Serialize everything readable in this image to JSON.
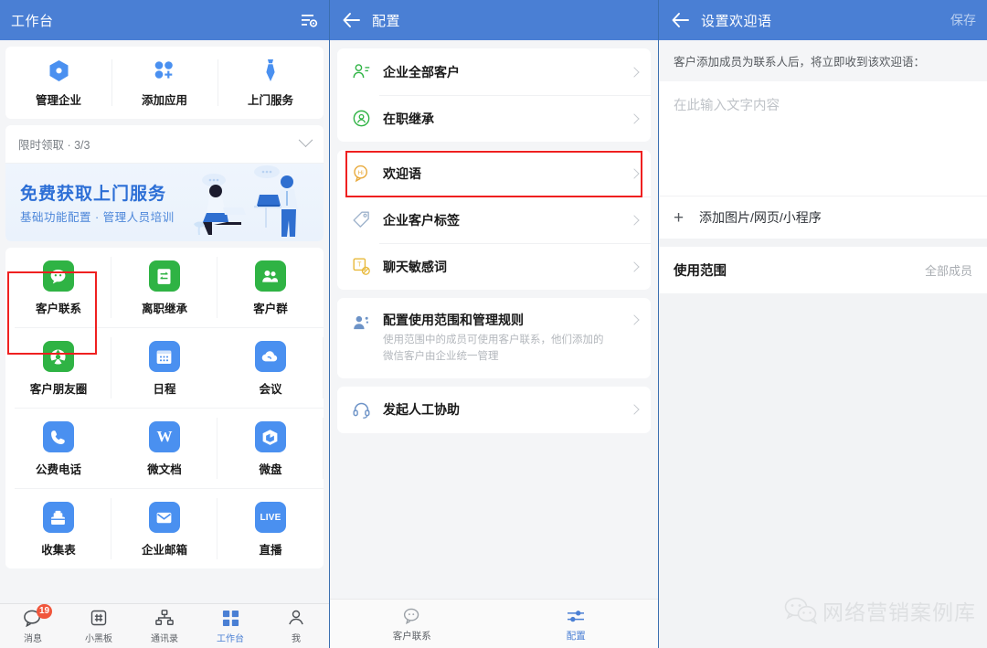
{
  "colors": {
    "appbar": "#4a7fd4",
    "accent": "#4a7fd4",
    "green": "#2fb344",
    "annotation": "#ef2020",
    "badge": "#f0563c"
  },
  "panel1": {
    "header": {
      "title": "工作台",
      "settings_icon": "list-settings-icon"
    },
    "quick_actions": [
      {
        "label": "管理企业",
        "icon": "hexagon-gear-icon"
      },
      {
        "label": "添加应用",
        "icon": "add-app-dots-icon"
      },
      {
        "label": "上门服务",
        "icon": "necktie-icon"
      }
    ],
    "limited": {
      "label": "限时领取 · 3/3",
      "chevron": "chevron-down-icon"
    },
    "banner": {
      "title": "免费获取上门服务",
      "subtitle": "基础功能配置 · 管理人员培训"
    },
    "apps": [
      {
        "label": "客户联系",
        "icon": "wechat-bubble-icon",
        "color": "#2fb344",
        "highlighted": true
      },
      {
        "label": "离职继承",
        "icon": "transfer-icon",
        "color": "#2fb344",
        "highlighted": false
      },
      {
        "label": "客户群",
        "icon": "group-people-icon",
        "color": "#2fb344",
        "highlighted": false
      },
      {
        "label": "客户朋友圈",
        "icon": "camera-shutter-icon",
        "color": "#2fb344",
        "highlighted": false
      },
      {
        "label": "日程",
        "icon": "calendar-icon",
        "color": "#4a90f0",
        "highlighted": false
      },
      {
        "label": "会议",
        "icon": "meeting-cloud-icon",
        "color": "#4a90f0",
        "highlighted": false
      },
      {
        "label": "公费电话",
        "icon": "phone-icon",
        "color": "#4a90f0",
        "highlighted": false
      },
      {
        "label": "微文档",
        "icon": "word-doc-icon",
        "color": "#4a90f0",
        "highlighted": false
      },
      {
        "label": "微盘",
        "icon": "drive-box-icon",
        "color": "#4a90f0",
        "highlighted": false
      },
      {
        "label": "收集表",
        "icon": "collect-form-icon",
        "color": "#4a90f0",
        "highlighted": false
      },
      {
        "label": "企业邮箱",
        "icon": "mail-envelope-icon",
        "color": "#4a90f0",
        "highlighted": false
      },
      {
        "label": "直播",
        "icon": "live-icon",
        "color": "#4a90f0",
        "highlighted": false
      }
    ],
    "tabbar": [
      {
        "label": "消息",
        "icon": "chat-bubble-icon",
        "badge": "19",
        "active": false
      },
      {
        "label": "小黑板",
        "icon": "blackboard-hash-icon",
        "badge": "",
        "active": false
      },
      {
        "label": "通讯录",
        "icon": "org-tree-icon",
        "badge": "",
        "active": false
      },
      {
        "label": "工作台",
        "icon": "grid-squares-icon",
        "badge": "",
        "active": true
      },
      {
        "label": "我",
        "icon": "person-icon",
        "badge": "",
        "active": false
      }
    ]
  },
  "panel2": {
    "header": {
      "title": "配置",
      "back_icon": "arrow-left-icon"
    },
    "group1": [
      {
        "label": "企业全部客户",
        "icon": "customer-list-icon",
        "highlighted": false
      },
      {
        "label": "在职继承",
        "icon": "inherit-circle-icon",
        "highlighted": false
      }
    ],
    "group2": [
      {
        "label": "欢迎语",
        "icon": "hi-bubble-icon",
        "highlighted": true
      },
      {
        "label": "企业客户标签",
        "icon": "tag-icon",
        "highlighted": false
      },
      {
        "label": "聊天敏感词",
        "icon": "sensitive-word-icon",
        "highlighted": false
      }
    ],
    "group3": [
      {
        "label": "配置使用范围和管理规则",
        "sub": "使用范围中的成员可使用客户联系，他们添加的微信客户由企业统一管理",
        "icon": "people-config-icon"
      }
    ],
    "group4": [
      {
        "label": "发起人工协助",
        "icon": "headset-support-icon"
      }
    ],
    "tabbar": [
      {
        "label": "客户联系",
        "icon": "wechat-outline-icon",
        "active": false
      },
      {
        "label": "配置",
        "icon": "sliders-icon",
        "active": true
      }
    ]
  },
  "panel3": {
    "header": {
      "title": "设置欢迎语",
      "back_icon": "arrow-left-icon",
      "save_label": "保存"
    },
    "hint": "客户添加成员为联系人后，将立即收到该欢迎语：",
    "editor_placeholder": "在此输入文字内容",
    "editor_value": "",
    "add_media_label": "添加图片/网页/小程序",
    "add_media_icon": "plus-icon",
    "scope": {
      "label": "使用范围",
      "value": "全部成员"
    },
    "watermark": {
      "text": "网络营销案例库",
      "icon": "wechat-logo-icon"
    }
  }
}
